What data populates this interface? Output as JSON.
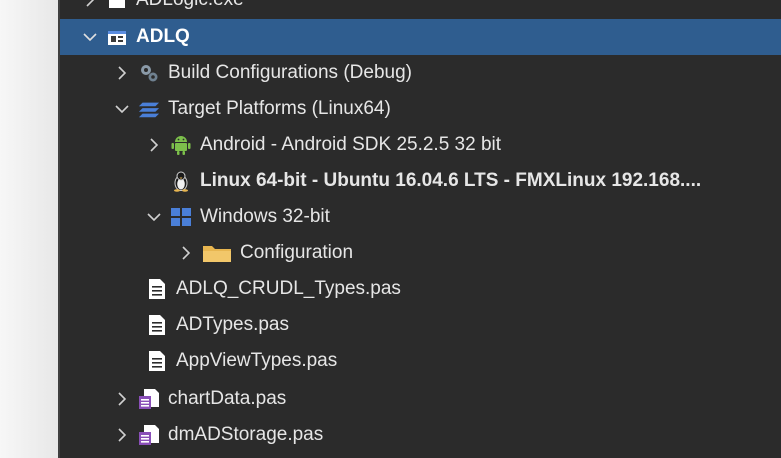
{
  "tree": {
    "items": [
      {
        "label": "ADLogic.exe",
        "icon": "exe-icon",
        "expander": "collapsed"
      },
      {
        "label": "ADLQ",
        "icon": "project-icon",
        "expander": "expanded",
        "selected": true
      },
      {
        "label": "Build Configurations (Debug)",
        "icon": "build-config-icon",
        "expander": "collapsed"
      },
      {
        "label": "Target Platforms (Linux64)",
        "icon": "target-platforms-icon",
        "expander": "expanded"
      },
      {
        "label": "Android - Android SDK 25.2.5 32 bit",
        "icon": "android-icon",
        "expander": "collapsed"
      },
      {
        "label": "Linux 64-bit - Ubuntu 16.04.6 LTS - FMXLinux 192.168....",
        "icon": "linux-icon",
        "expander": "none",
        "bold": true
      },
      {
        "label": "Windows 32-bit",
        "icon": "windows-icon",
        "expander": "expanded"
      },
      {
        "label": "Configuration",
        "icon": "folder-icon",
        "expander": "collapsed"
      },
      {
        "label": "ADLQ_CRUDL_Types.pas",
        "icon": "pas-file-icon",
        "expander": "none"
      },
      {
        "label": "ADTypes.pas",
        "icon": "pas-file-icon",
        "expander": "none"
      },
      {
        "label": "AppViewTypes.pas",
        "icon": "pas-file-icon",
        "expander": "none"
      },
      {
        "label": "chartData.pas",
        "icon": "form-file-icon",
        "expander": "collapsed"
      },
      {
        "label": "dmADStorage.pas",
        "icon": "form-file-icon",
        "expander": "collapsed"
      }
    ]
  },
  "colors": {
    "panel_bg": "#2b2b2b",
    "selected_bg": "#2f5d8f",
    "text": "#e6e6e6",
    "accent_blue": "#4a7fd8",
    "android_green": "#7cc04b",
    "folder_yellow": "#e8b650"
  }
}
